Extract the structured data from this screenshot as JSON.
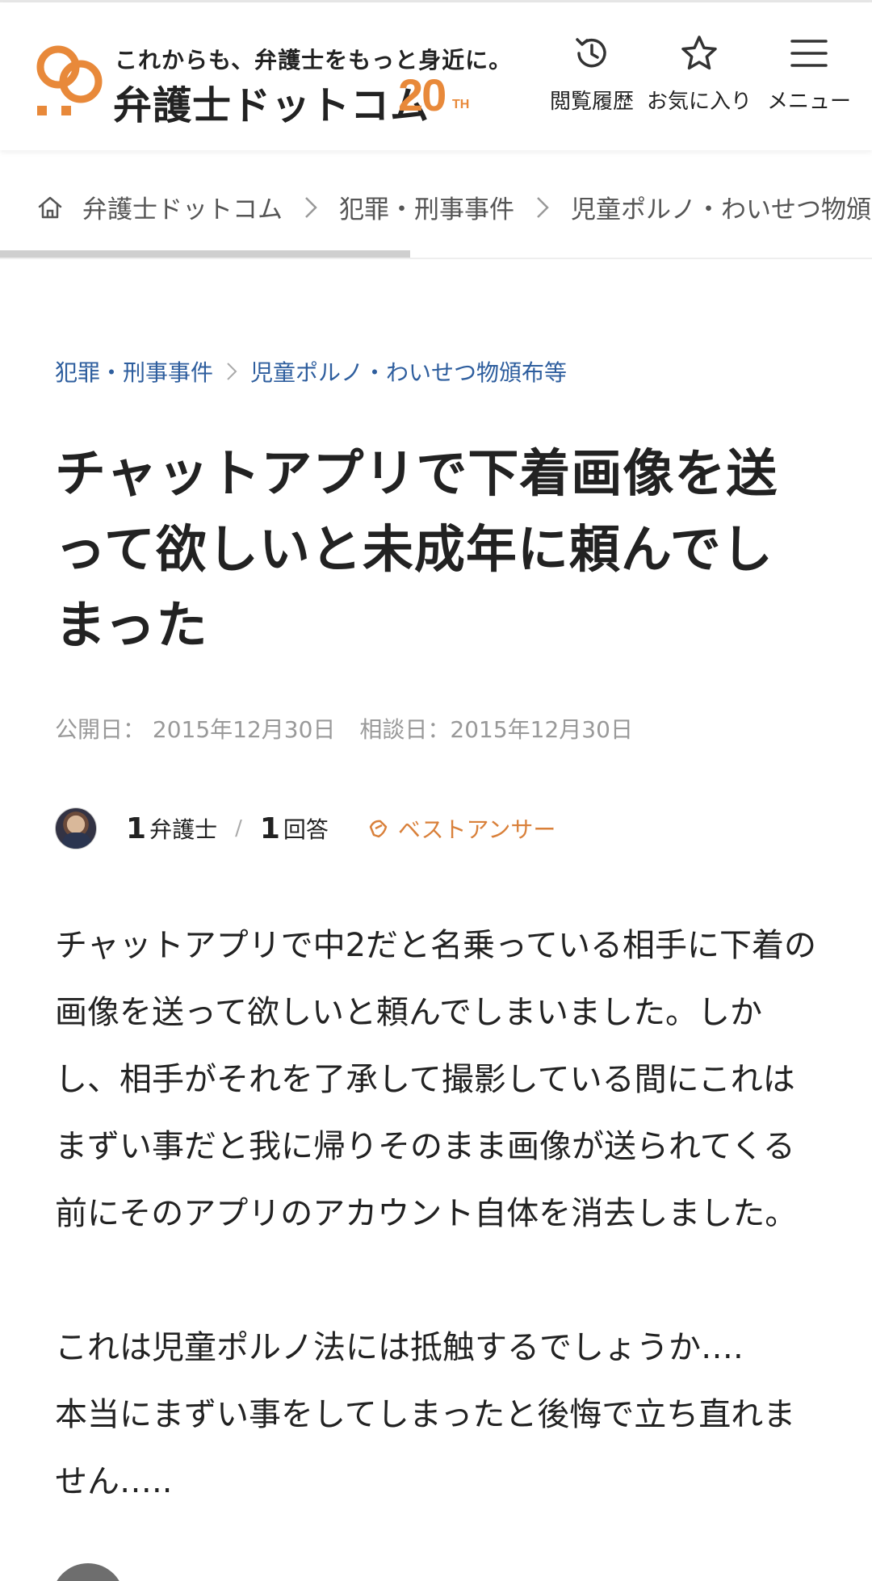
{
  "header": {
    "tagline": "これからも、弁護士をもっと身近に。",
    "site_name": "弁護士ドットコム",
    "anniversary_number": "20",
    "anniversary_suffix": "TH",
    "history_label": "閲覧履歴",
    "favorites_label": "お気に入り",
    "menu_label": "メニュー",
    "brand_color": "#e8893a"
  },
  "breadcrumb": {
    "items": [
      "弁護士ドットコム",
      "犯罪・刑事事件",
      "児童ポルノ・わいせつ物頒布等"
    ]
  },
  "category_path": {
    "items": [
      "犯罪・刑事事件",
      "児童ポルノ・わいせつ物頒布等"
    ],
    "link_color": "#2e5e9e"
  },
  "question": {
    "title": "チャットアプリで下着画像を送って欲しいと未成年に頼んでしまった",
    "published": "公開日： 2015年12月30日",
    "consulted": "相談日：2015年12月30日",
    "lawyer_count": "1",
    "lawyer_unit": "弁護士",
    "answer_count": "1",
    "answer_unit": "回答",
    "best_answer_label": "ベストアンサー",
    "body": [
      "チャットアプリで中2だと名乗っている相手に下着の画像を送って欲しいと頼んでしまいました。しかし、相手がそれを了承して撮影している間にこれはまずい事だと我に帰りそのまま画像が送られてくる前にそのアプリのアカウント自体を消去しました。",
      "これは児童ポルノ法には抵触するでしょうか….\n本当にまずい事をしてしまったと後悔で立ち直れません…..\n"
    ]
  }
}
